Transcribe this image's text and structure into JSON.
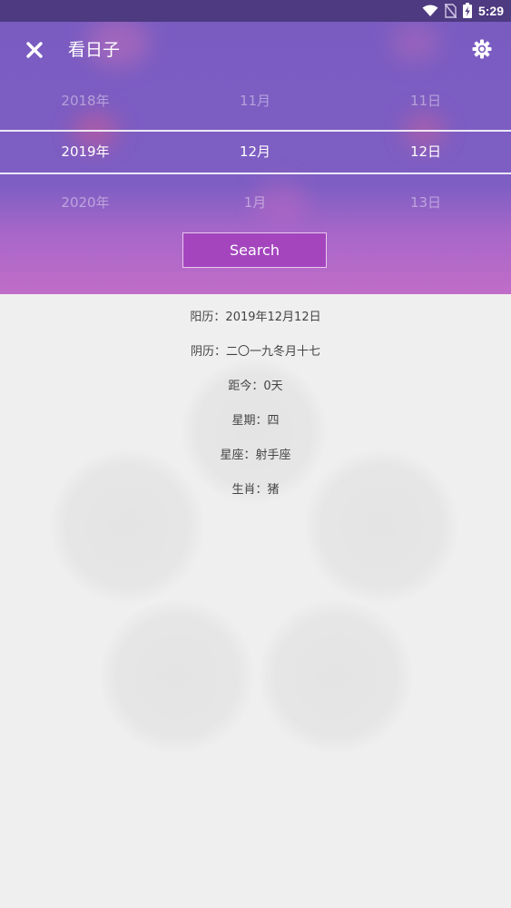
{
  "status_bar": {
    "time": "5:29",
    "icons": [
      "wifi-icon",
      "no-sim-icon",
      "battery-charging-icon"
    ]
  },
  "toolbar": {
    "close_icon": "close-icon",
    "title": "看日子",
    "settings_icon": "settings-icon"
  },
  "picker": {
    "years": [
      "2018年",
      "2019年",
      "2020年"
    ],
    "months": [
      "11月",
      "12月",
      "1月"
    ],
    "days": [
      "11日",
      "12日",
      "13日"
    ],
    "selected_index": 1
  },
  "search_label": "Search",
  "info": [
    {
      "label": "阳历：",
      "value": "2019年12月12日"
    },
    {
      "label": "阴历：",
      "value": "二〇一九冬月十七"
    },
    {
      "label": "距今：",
      "value": "0天"
    },
    {
      "label": "星期：",
      "value": "四"
    },
    {
      "label": "星座：",
      "value": "射手座"
    },
    {
      "label": "生肖：",
      "value": "猪"
    }
  ],
  "colors": {
    "header_top": "#7a5cc1",
    "header_bottom": "#c06dc8",
    "search_button": "#a445be",
    "background": "#efefef"
  }
}
